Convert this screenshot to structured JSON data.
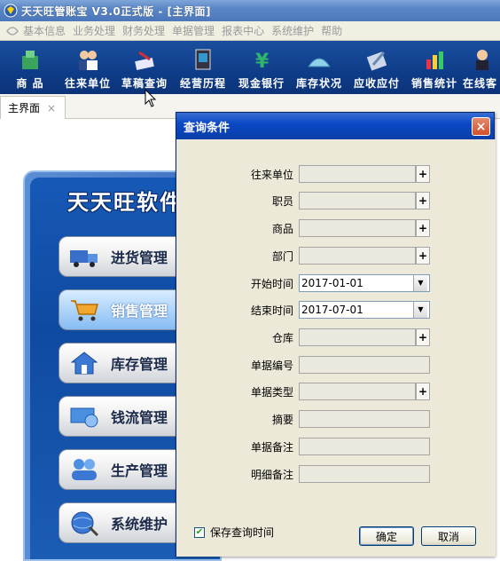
{
  "window": {
    "title": "天天旺管账宝 V3.0正式版 - [主界面]"
  },
  "menu": {
    "items": [
      "基本信息",
      "业务处理",
      "财务处理",
      "单据管理",
      "报表中心",
      "系统维护",
      "帮助"
    ]
  },
  "toolbar": {
    "items": [
      {
        "label": "商 品",
        "icon": "product-icon"
      },
      {
        "label": "往来单位",
        "icon": "contacts-icon"
      },
      {
        "label": "草稿查询",
        "icon": "draft-query-icon"
      },
      {
        "label": "经营历程",
        "icon": "history-icon"
      },
      {
        "label": "现金银行",
        "icon": "cash-bank-icon"
      },
      {
        "label": "库存状况",
        "icon": "inventory-icon"
      },
      {
        "label": "应收应付",
        "icon": "receivable-icon"
      },
      {
        "label": "销售统计",
        "icon": "sales-stats-icon"
      },
      {
        "label": "在线客",
        "icon": "online-icon"
      }
    ]
  },
  "tabs": [
    {
      "label": "主界面",
      "close": "×"
    }
  ],
  "panel": {
    "title": "天天旺软件",
    "modules": [
      {
        "label": "进货管理",
        "icon": "purchase-truck-icon"
      },
      {
        "label": "销售管理",
        "icon": "sales-cart-icon"
      },
      {
        "label": "库存管理",
        "icon": "warehouse-icon"
      },
      {
        "label": "钱流管理",
        "icon": "money-icon"
      },
      {
        "label": "生产管理",
        "icon": "production-icon"
      },
      {
        "label": "系统维护",
        "icon": "system-globe-icon"
      }
    ]
  },
  "dialog": {
    "title": "查询条件",
    "close": "×",
    "fields": [
      {
        "label": "往来单位",
        "value": "",
        "kind": "lookup"
      },
      {
        "label": "职员",
        "value": "",
        "kind": "lookup"
      },
      {
        "label": "商品",
        "value": "",
        "kind": "lookup"
      },
      {
        "label": "部门",
        "value": "",
        "kind": "lookup"
      },
      {
        "label": "开始时间",
        "value": "2017-01-01",
        "kind": "date"
      },
      {
        "label": "结束时间",
        "value": "2017-07-01",
        "kind": "date"
      },
      {
        "label": "仓库",
        "value": "",
        "kind": "lookup"
      },
      {
        "label": "单据编号",
        "value": "",
        "kind": "text"
      },
      {
        "label": "单据类型",
        "value": "",
        "kind": "lookup"
      },
      {
        "label": "摘要",
        "value": "",
        "kind": "text"
      },
      {
        "label": "单据备注",
        "value": "",
        "kind": "text"
      },
      {
        "label": "明细备注",
        "value": "",
        "kind": "text"
      }
    ],
    "plus_glyph": "+",
    "dropdown_glyph": "▼",
    "save_time": {
      "label": "保存查询时间",
      "checked": true,
      "check_glyph": "✔"
    },
    "ok_label": "确定",
    "cancel_label": "取消"
  },
  "colors": {
    "toolbar_bg": "#0f3c88",
    "dialog_title": "#0b48c5",
    "panel_bg": "#1659b6"
  }
}
